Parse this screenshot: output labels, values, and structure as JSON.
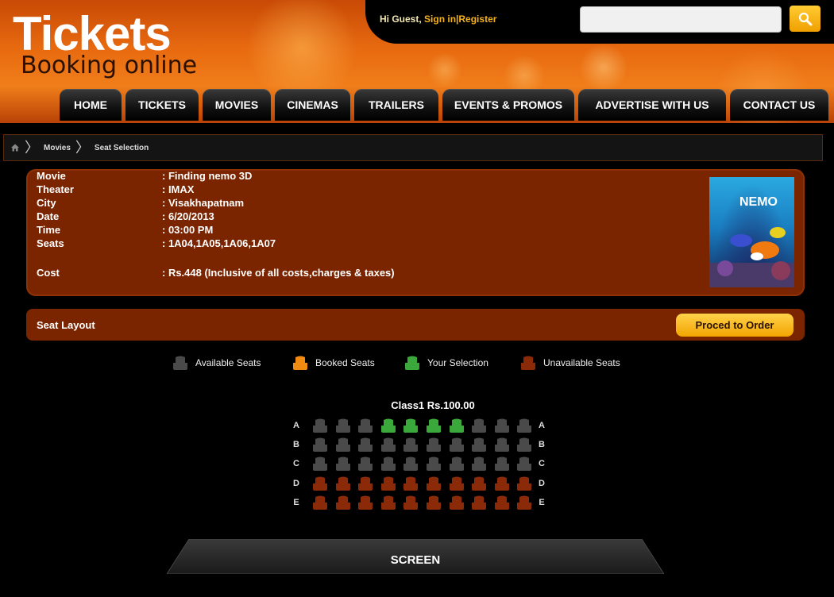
{
  "header": {
    "logo_title": "Tickets",
    "logo_subtitle": "Booking online",
    "greeting_prefix": "Hi Guest,",
    "sign_in": "Sign in|",
    "register": "Register",
    "search_placeholder": "",
    "search_icon": "search-icon"
  },
  "nav": {
    "items": [
      "HOME",
      "TICKETS",
      "MOVIES",
      "CINEMAS",
      "TRAILERS",
      "EVENTS & PROMOS",
      "ADVERTISE WITH US",
      "CONTACT US"
    ]
  },
  "breadcrumb": {
    "home_icon": "home-icon",
    "items": [
      "Movies",
      "Seat Selection"
    ]
  },
  "details": {
    "rows": [
      {
        "label": "Movie",
        "value": ": Finding nemo 3D"
      },
      {
        "label": "Theater",
        "value": ": IMAX"
      },
      {
        "label": "City",
        "value": ": Visakhapatnam"
      },
      {
        "label": "Date",
        "value": ": 6/20/2013"
      },
      {
        "label": "Time",
        "value": ": 03:00 PM"
      },
      {
        "label": "Seats",
        "value": ": 1A04,1A05,1A06,1A07"
      },
      {
        "label": "Cost",
        "value": ": Rs.448 (Inclusive of all costs,charges & taxes)"
      }
    ],
    "poster_text": "NEMO"
  },
  "seat_layout": {
    "title": "Seat Layout",
    "order_button": "Proced to Order"
  },
  "legend": [
    {
      "label": "Available Seats",
      "color": "#4a4a4a"
    },
    {
      "label": "Booked Seats",
      "color": "#f08a10"
    },
    {
      "label": "Your Selection",
      "color": "#3aa83a"
    },
    {
      "label": "Unavailable Seats",
      "color": "#8a2a08"
    }
  ],
  "seat_map": {
    "class_label": "Class1 Rs.100.00",
    "rows": [
      {
        "label": "A",
        "seats": [
          "available",
          "available",
          "available",
          "selected",
          "selected",
          "selected",
          "selected",
          "available",
          "available",
          "available"
        ]
      },
      {
        "label": "B",
        "seats": [
          "available",
          "available",
          "available",
          "available",
          "available",
          "available",
          "available",
          "available",
          "available",
          "available"
        ]
      },
      {
        "label": "C",
        "seats": [
          "available",
          "available",
          "available",
          "available",
          "available",
          "available",
          "available",
          "available",
          "available",
          "available"
        ]
      },
      {
        "label": "D",
        "seats": [
          "unavailable",
          "unavailable",
          "unavailable",
          "unavailable",
          "unavailable",
          "unavailable",
          "unavailable",
          "unavailable",
          "unavailable",
          "unavailable"
        ]
      },
      {
        "label": "E",
        "seats": [
          "unavailable",
          "unavailable",
          "unavailable",
          "unavailable",
          "unavailable",
          "unavailable",
          "unavailable",
          "unavailable",
          "unavailable",
          "unavailable"
        ]
      }
    ],
    "colors": {
      "available": "#4a4a4a",
      "booked": "#f08a10",
      "selected": "#3aa83a",
      "unavailable": "#8a2a08"
    }
  },
  "screen_label": "SCREEN"
}
